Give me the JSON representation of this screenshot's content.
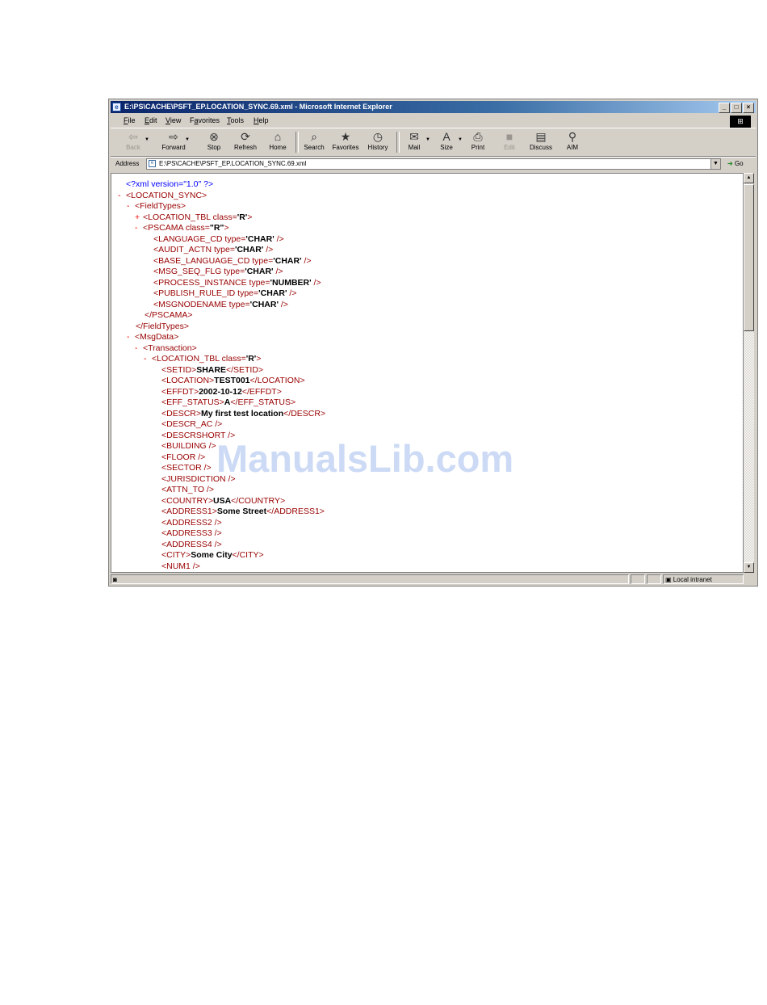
{
  "window": {
    "title": "E:\\PS\\CACHE\\PSFT_EP.LOCATION_SYNC.69.xml - Microsoft Internet Explorer",
    "controls": [
      "_",
      "□",
      "×"
    ]
  },
  "menu": {
    "items": [
      {
        "label": "File",
        "accel": "F",
        "rest": "ile"
      },
      {
        "label": "Edit",
        "accel": "E",
        "rest": "dit"
      },
      {
        "label": "View",
        "accel": "V",
        "rest": "iew"
      },
      {
        "label": "Favorites",
        "accel": "a",
        "pre": "F",
        "rest": "vorites"
      },
      {
        "label": "Tools",
        "accel": "T",
        "rest": "ools"
      },
      {
        "label": "Help",
        "accel": "H",
        "rest": "elp"
      }
    ]
  },
  "toolbar": {
    "back": "Back",
    "forward": "Forward",
    "stop": "Stop",
    "refresh": "Refresh",
    "home": "Home",
    "search": "Search",
    "favorites": "Favorites",
    "history": "History",
    "mail": "Mail",
    "size": "Size",
    "print": "Print",
    "edit": "Edit",
    "discuss": "Discuss",
    "aim": "AIM"
  },
  "address": {
    "label": "Address",
    "value": "E:\\PS\\CACHE\\PSFT_EP.LOCATION_SYNC.69.xml",
    "go": "Go"
  },
  "xml": {
    "pi": "<?xml version=\"1.0\" ?>",
    "root": "<LOCATION_SYNC>",
    "fieldtypes_open": "<FieldTypes>",
    "location_tbl_collapsed": "<LOCATION_TBL class=",
    "location_tbl_class": "'R'",
    "pscama_open": "<PSCAMA class=",
    "pscama_class": "\"R\"",
    "fields": [
      {
        "name": "<LANGUAGE_CD type=",
        "type": "'CHAR'"
      },
      {
        "name": "<AUDIT_ACTN type=",
        "type": "'CHAR'"
      },
      {
        "name": "<BASE_LANGUAGE_CD type=",
        "type": "'CHAR'"
      },
      {
        "name": "<MSG_SEQ_FLG type=",
        "type": "'CHAR'"
      },
      {
        "name": "<PROCESS_INSTANCE type=",
        "type": "'NUMBER'"
      },
      {
        "name": "<PUBLISH_RULE_ID type=",
        "type": "'CHAR'"
      },
      {
        "name": "<MSGNODENAME type=",
        "type": "'CHAR'"
      }
    ],
    "self_close": " />",
    "pscama_close": "</PSCAMA>",
    "fieldtypes_close": "</FieldTypes>",
    "msgdata_open": "<MsgData>",
    "transaction_open": "<Transaction>",
    "location_tbl_open": "<LOCATION_TBL class=",
    "location_tbl_open_class": "'R'",
    "rows": [
      {
        "open": "<SETID>",
        "value": "SHARE",
        "close": "</SETID>"
      },
      {
        "open": "<LOCATION>",
        "value": "TEST001",
        "close": "</LOCATION>"
      },
      {
        "open": "<EFFDT>",
        "value": "2002-10-12",
        "close": "</EFFDT>"
      },
      {
        "open": "<EFF_STATUS>",
        "value": "A",
        "close": "</EFF_STATUS>"
      },
      {
        "open": "<DESCR>",
        "value": "My first test location",
        "close": "</DESCR>"
      },
      {
        "open": "<DESCR_AC />",
        "value": "",
        "close": ""
      },
      {
        "open": "<DESCRSHORT />",
        "value": "",
        "close": ""
      },
      {
        "open": "<BUILDING />",
        "value": "",
        "close": ""
      },
      {
        "open": "<FLOOR />",
        "value": "",
        "close": ""
      },
      {
        "open": "<SECTOR />",
        "value": "",
        "close": ""
      },
      {
        "open": "<JURISDICTION />",
        "value": "",
        "close": ""
      },
      {
        "open": "<ATTN_TO />",
        "value": "",
        "close": ""
      },
      {
        "open": "<COUNTRY>",
        "value": "USA",
        "close": "</COUNTRY>"
      },
      {
        "open": "<ADDRESS1>",
        "value": "Some Street",
        "close": "</ADDRESS1>"
      },
      {
        "open": "<ADDRESS2 />",
        "value": "",
        "close": ""
      },
      {
        "open": "<ADDRESS3 />",
        "value": "",
        "close": ""
      },
      {
        "open": "<ADDRESS4 />",
        "value": "",
        "close": ""
      },
      {
        "open": "<CITY>",
        "value": "Some City",
        "close": "</CITY>"
      },
      {
        "open": "<NUM1 />",
        "value": "",
        "close": ""
      }
    ]
  },
  "status": {
    "zone": "Local intranet"
  },
  "watermark": "ManualsLib.com"
}
